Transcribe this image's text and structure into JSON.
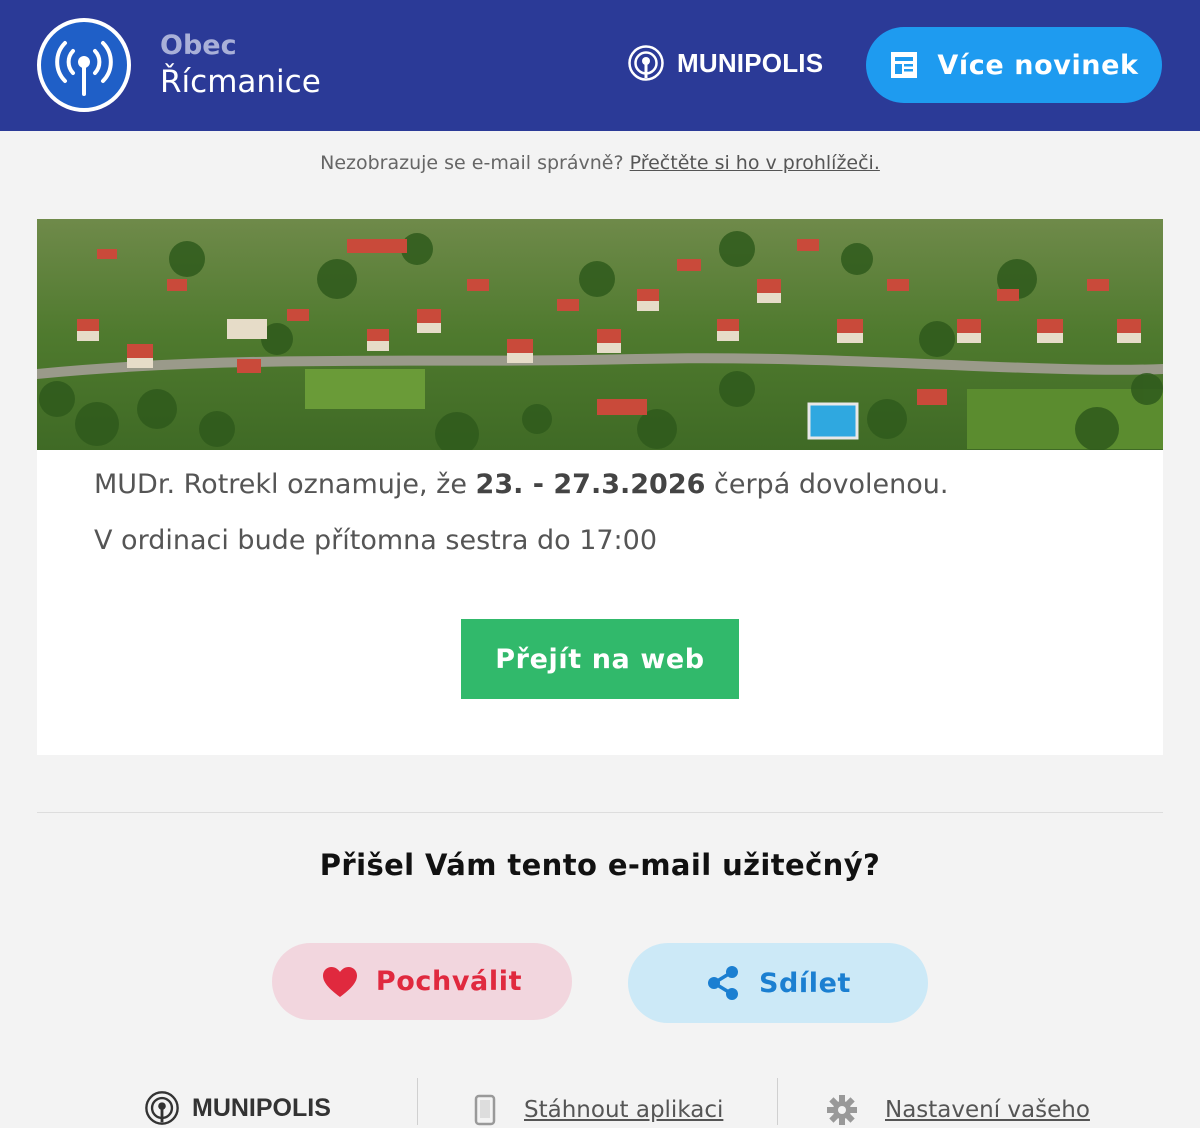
{
  "header": {
    "brand_top": "Obec",
    "brand_bottom": "Řícmanice",
    "munipolis_label": "MUNIPOLIS",
    "more_news_label": "Více novinek"
  },
  "notice": {
    "text": "Nezobrazuje se e-mail správně?",
    "link": "Přečtěte si ho v prohlížeči."
  },
  "article": {
    "line1_start": "MUDr. Rotrekl oznamuje, že ",
    "line1_bold": "23. - 27.3.2026",
    "line1_end": " čerpá dovolenou.",
    "line2": "V ordinaci bude přítomna sestra do 17:00",
    "button_label": "Přejít na web"
  },
  "feedback": {
    "question": "Přišel Vám tento e-mail užitečný?",
    "praise_label": "Pochválit",
    "share_label": "Sdílet"
  },
  "footer": {
    "munipolis_label": "MUNIPOLIS",
    "download_app": "Stáhnout aplikaci",
    "settings": "Nastavení vašeho"
  },
  "colors": {
    "header_bg": "#2b3a97",
    "more_btn": "#1e9bf0",
    "web_btn": "#31b96b",
    "praise_text": "#e0293e",
    "share_text": "#1b7fd1"
  }
}
